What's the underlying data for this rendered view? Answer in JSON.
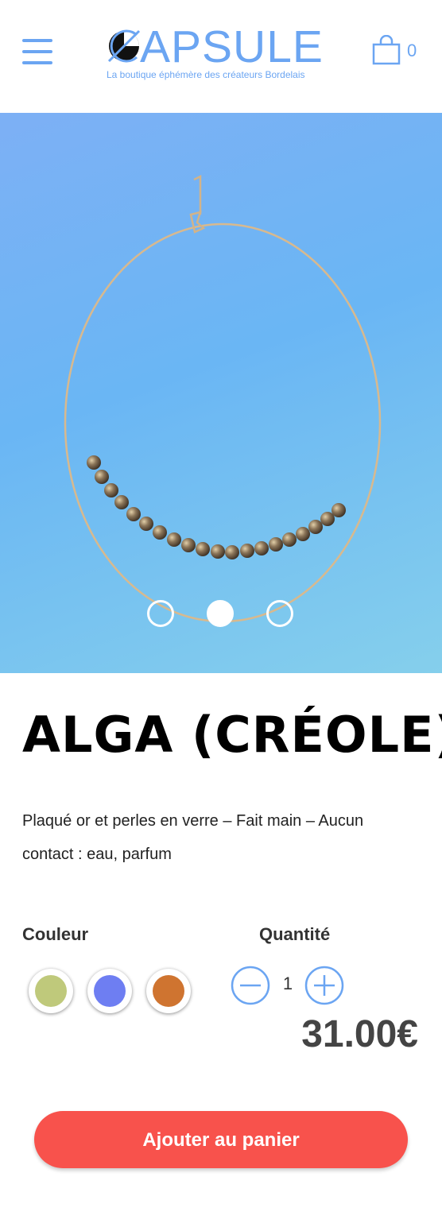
{
  "header": {
    "logo_text": "APSULE",
    "logo_subtitle": "La boutique éphémère des créateurs Bordelais",
    "cart_count": "0",
    "accent_color": "#6ba5f2"
  },
  "gallery": {
    "slides_count": 3,
    "active_slide": 2
  },
  "product": {
    "title": "ALGA (CRÉOLE)",
    "description": "Plaqué or et perles en verre – Fait main – Aucun contact : eau, parfum",
    "color_label": "Couleur",
    "quantity_label": "Quantité",
    "colors": [
      {
        "name": "green",
        "hex": "#bfc97b"
      },
      {
        "name": "blue",
        "hex": "#6e7ef2"
      },
      {
        "name": "orange",
        "hex": "#cf7430"
      }
    ],
    "quantity": "1",
    "price": "31.00€",
    "add_to_cart_label": "Ajouter au panier",
    "button_color": "#f8524c"
  }
}
